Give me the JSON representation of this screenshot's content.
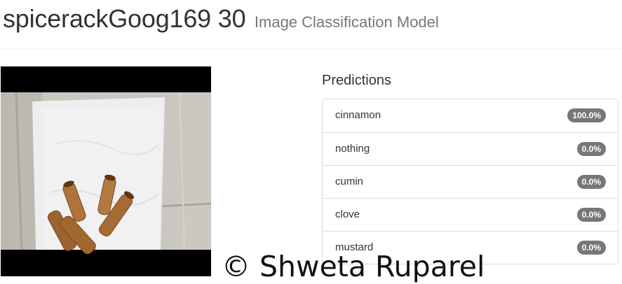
{
  "header": {
    "model_name": "spicerackGoog169 30",
    "model_subtitle": "Image Classification Model"
  },
  "image": {
    "icon": "cinnamon-sticks-photo"
  },
  "predictions": {
    "title": "Predictions",
    "items": [
      {
        "label": "cinnamon",
        "score": "100.0%"
      },
      {
        "label": "nothing",
        "score": "0.0%"
      },
      {
        "label": "cumin",
        "score": "0.0%"
      },
      {
        "label": "clove",
        "score": "0.0%"
      },
      {
        "label": "mustard",
        "score": "0.0%"
      }
    ],
    "badge_color": "#777777"
  },
  "watermark": {
    "text": "© Shweta Ruparel"
  }
}
